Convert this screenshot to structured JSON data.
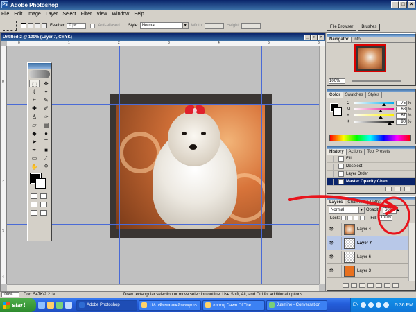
{
  "app": {
    "title": "Adobe Photoshop",
    "logo_text": "Ps"
  },
  "menu": [
    "File",
    "Edit",
    "Image",
    "Layer",
    "Select",
    "Filter",
    "View",
    "Window",
    "Help"
  ],
  "options": {
    "feather_label": "Feather:",
    "feather_value": "0 px",
    "antialiased_label": "Anti-aliased",
    "style_label": "Style:",
    "style_value": "Normal",
    "width_label": "Width:",
    "height_label": "Height:"
  },
  "palette_well": [
    "File Browser",
    "Brushes"
  ],
  "document": {
    "title": "Untitled-2 @ 100% (Layer 7, CMYK)",
    "ruler_top": [
      "0",
      "1",
      "2",
      "3",
      "4",
      "5",
      "6"
    ],
    "ruler_left": [
      "0",
      "1",
      "2",
      "3",
      "4",
      "5"
    ]
  },
  "status": {
    "zoom": "100%",
    "doc_size": "Doc: 547K/2.21M",
    "hint": "Draw rectangular selection or move selection outline. Use Shift, Alt, and Ctrl for additional options."
  },
  "navigator": {
    "tabs": [
      "Navigator",
      "Info"
    ],
    "zoom": "100%"
  },
  "color": {
    "tabs": [
      "Color",
      "Swatches",
      "Styles"
    ],
    "channels": [
      {
        "name": "C",
        "value": "75",
        "fraction": 0.75
      },
      {
        "name": "M",
        "value": "68",
        "fraction": 0.68
      },
      {
        "name": "Y",
        "value": "67",
        "fraction": 0.67
      },
      {
        "name": "K",
        "value": "90",
        "fraction": 0.9
      }
    ],
    "unit": "%"
  },
  "history": {
    "tabs": [
      "History",
      "Actions",
      "Tool Presets"
    ],
    "items": [
      "Fill",
      "Deselect",
      "Layer Order",
      "Master Opacity Chan..."
    ]
  },
  "layers": {
    "tabs": [
      "Layers",
      "Channels",
      "Paths"
    ],
    "blend_mode": "Normal",
    "opacity_label": "Opacity:",
    "opacity_value": "60%",
    "lock_label": "Lock:",
    "fill_label": "Fill:",
    "fill_value": "100%",
    "items": [
      "Layer 4",
      "Layer 7",
      "Layer 6",
      "Layer 3"
    ]
  },
  "taskbar": {
    "start": "start",
    "tasks": [
      "Adobe Photoshop",
      "118. เพิ่มพลอยคลิกเหตุการ...",
      "อยากดู Dawn Of The ...",
      "Jusmine - Conversation"
    ],
    "language": "EN",
    "clock": "5:36 PM"
  },
  "colors": {
    "annotation": "#e8141c",
    "title_bar": "#0a246a",
    "taskbar": "#245edb"
  }
}
